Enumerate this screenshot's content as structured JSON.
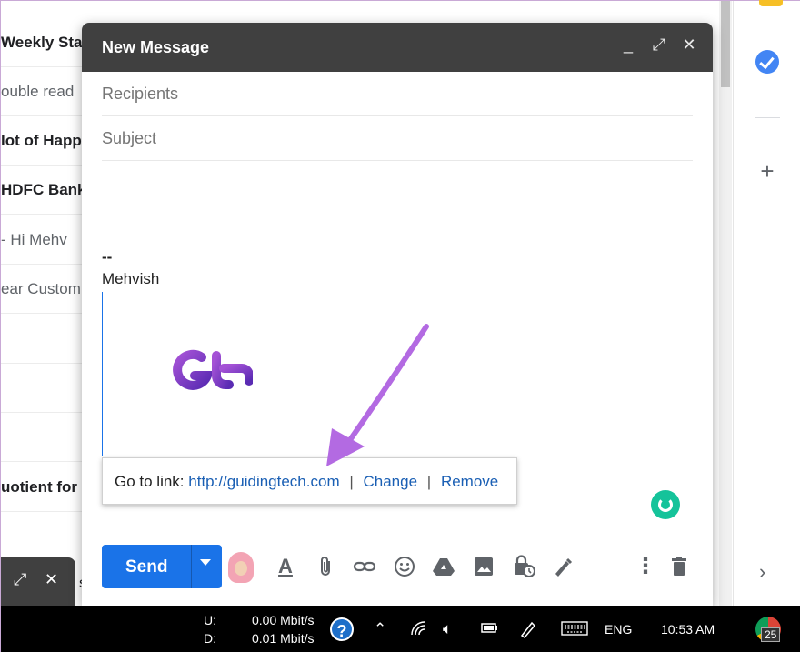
{
  "inbox": {
    "rows": [
      {
        "text": "Weekly Stat",
        "style": "bold"
      },
      {
        "text": "ouble read",
        "style": "light"
      },
      {
        "text": "lot of Happ",
        "style": "bold"
      },
      {
        "text": "HDFC Bank",
        "style": "bold"
      },
      {
        "text": "- Hi Mehv",
        "style": "light"
      },
      {
        "text": "ear Custom",
        "style": "light"
      },
      {
        "text": "",
        "style": "light"
      },
      {
        "text": "",
        "style": "light"
      },
      {
        "text": "",
        "style": "light"
      },
      {
        "text": "uotient for",
        "style": "bold"
      }
    ],
    "behind_draft_char": "s"
  },
  "compose": {
    "title": "New Message",
    "recipients_placeholder": "Recipients",
    "subject_placeholder": "Subject",
    "signature_dash": "--",
    "signature_name": "Mehvish",
    "link_popup": {
      "prefix": "Go to link:",
      "url": "http://guidingtech.com",
      "change": "Change",
      "remove": "Remove",
      "separator": "|"
    },
    "send_label": "Send"
  },
  "taskbar": {
    "upload_label": "U:",
    "download_label": "D:",
    "upload_speed": "0.00 Mbit/s",
    "download_speed": "0.01 Mbit/s",
    "language": "ENG",
    "time": "10:53 AM",
    "chrome_badge": "25"
  },
  "colors": {
    "accent": "#1a73e8",
    "header": "#404040",
    "arrow": "#b36ae2",
    "logo_gradient_start": "#a552d6",
    "logo_gradient_end": "#5a2bb3"
  }
}
